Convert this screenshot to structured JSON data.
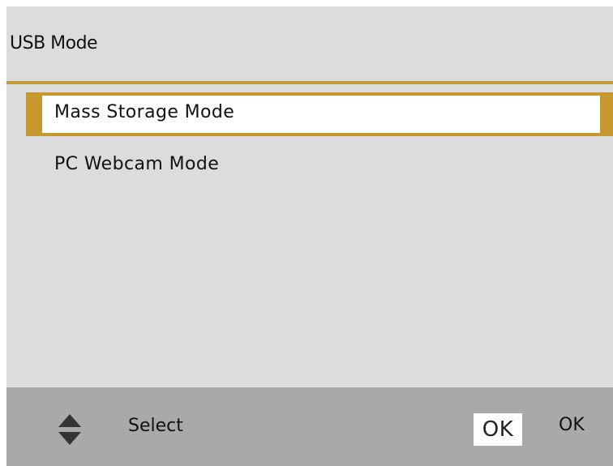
{
  "header": {
    "title": "USB Mode"
  },
  "menu": {
    "items": [
      {
        "label": "Mass Storage Mode",
        "selected": true
      },
      {
        "label": "PC Webcam Mode",
        "selected": false
      }
    ]
  },
  "footer": {
    "navigate_icon": "up-down-arrows-icon",
    "select_label": "Select",
    "ok_key": "OK",
    "ok_label": "OK"
  },
  "colors": {
    "accent": "#c6962f",
    "background": "#dcdcdc",
    "footer_background": "#a9a9a9",
    "selected_background": "#ffffff"
  }
}
